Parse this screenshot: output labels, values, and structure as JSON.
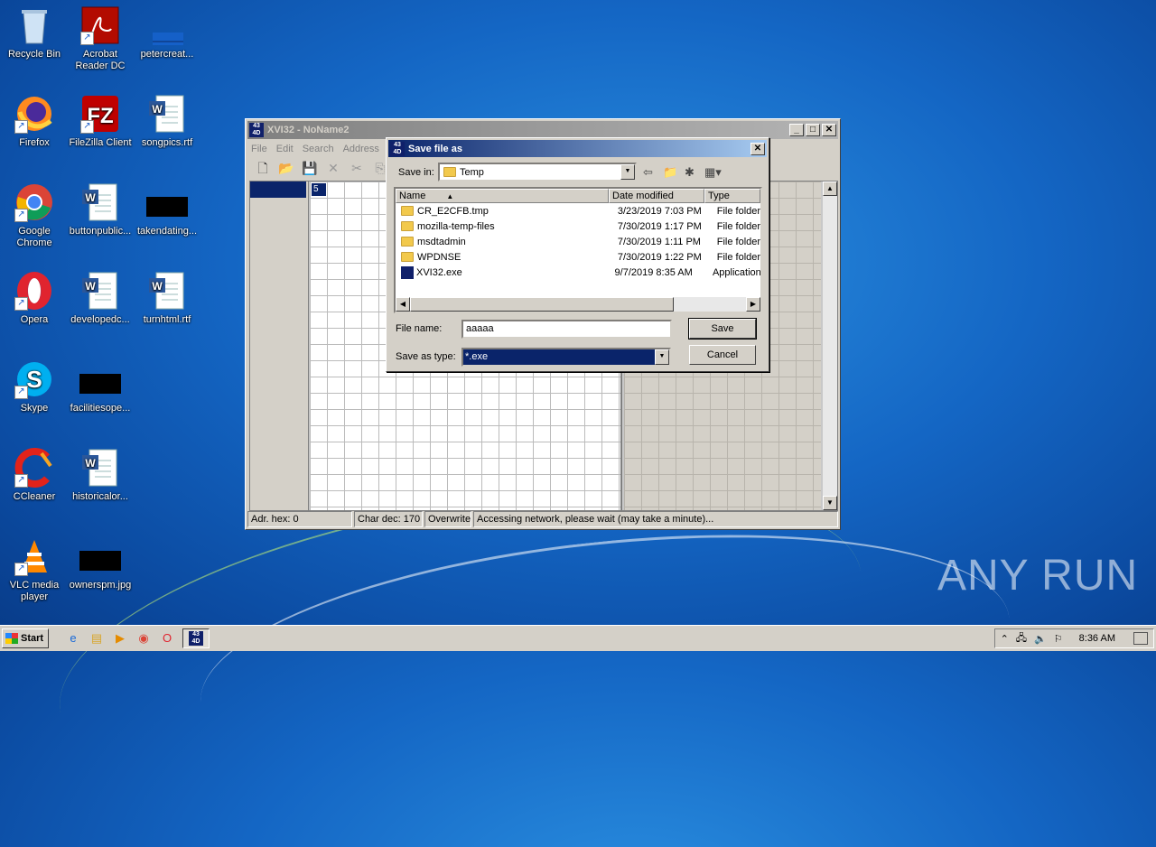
{
  "desktop": {
    "icons": [
      {
        "label": "Recycle Bin"
      },
      {
        "label": "Acrobat Reader DC"
      },
      {
        "label": "petercreat..."
      },
      {
        "label": "Firefox"
      },
      {
        "label": "FileZilla Client"
      },
      {
        "label": "songpics.rtf"
      },
      {
        "label": "Google Chrome"
      },
      {
        "label": "buttonpublic..."
      },
      {
        "label": "takendating..."
      },
      {
        "label": "Opera"
      },
      {
        "label": "developedc..."
      },
      {
        "label": "turnhtml.rtf"
      },
      {
        "label": "Skype"
      },
      {
        "label": "facilitiesope..."
      },
      {
        "label": "CCleaner"
      },
      {
        "label": "historicalor..."
      },
      {
        "label": "VLC media player"
      },
      {
        "label": "ownerspm.jpg"
      }
    ],
    "watermark": "ANY RUN"
  },
  "app": {
    "title": "XVI32 - NoName2",
    "menu": [
      "File",
      "Edit",
      "Search",
      "Address"
    ],
    "toolbar_icons": [
      "new-icon",
      "open-icon",
      "save-icon",
      "cut-icon",
      "scissors-icon",
      "copy-icon"
    ],
    "hex_cell": "5",
    "status": {
      "addr": "Adr. hex: 0",
      "char": "Char dec: 170",
      "mode": "Overwrite",
      "message": "Accessing network, please wait (may take a minute)..."
    }
  },
  "dialog": {
    "title": "Save file as",
    "save_in_label": "Save in:",
    "save_in_value": "Temp",
    "columns": [
      "Name",
      "Date modified",
      "Type"
    ],
    "files": [
      {
        "name": "CR_E2CFB.tmp",
        "date": "3/23/2019 7:03 PM",
        "type": "File folder",
        "icon": "folder-icon"
      },
      {
        "name": "mozilla-temp-files",
        "date": "7/30/2019 1:17 PM",
        "type": "File folder",
        "icon": "folder-icon"
      },
      {
        "name": "msdtadmin",
        "date": "7/30/2019 1:11 PM",
        "type": "File folder",
        "icon": "folder-icon"
      },
      {
        "name": "WPDNSE",
        "date": "7/30/2019 1:22 PM",
        "type": "File folder",
        "icon": "folder-icon"
      },
      {
        "name": "XVI32.exe",
        "date": "9/7/2019 8:35 AM",
        "type": "Application",
        "icon": "exe-icon"
      }
    ],
    "file_name_label": "File name:",
    "file_name_value": "aaaaa",
    "save_type_label": "Save as type:",
    "save_type_value": "*.exe",
    "save_button": "Save",
    "cancel_button": "Cancel"
  },
  "taskbar": {
    "start": "Start",
    "clock": "8:36 AM"
  }
}
